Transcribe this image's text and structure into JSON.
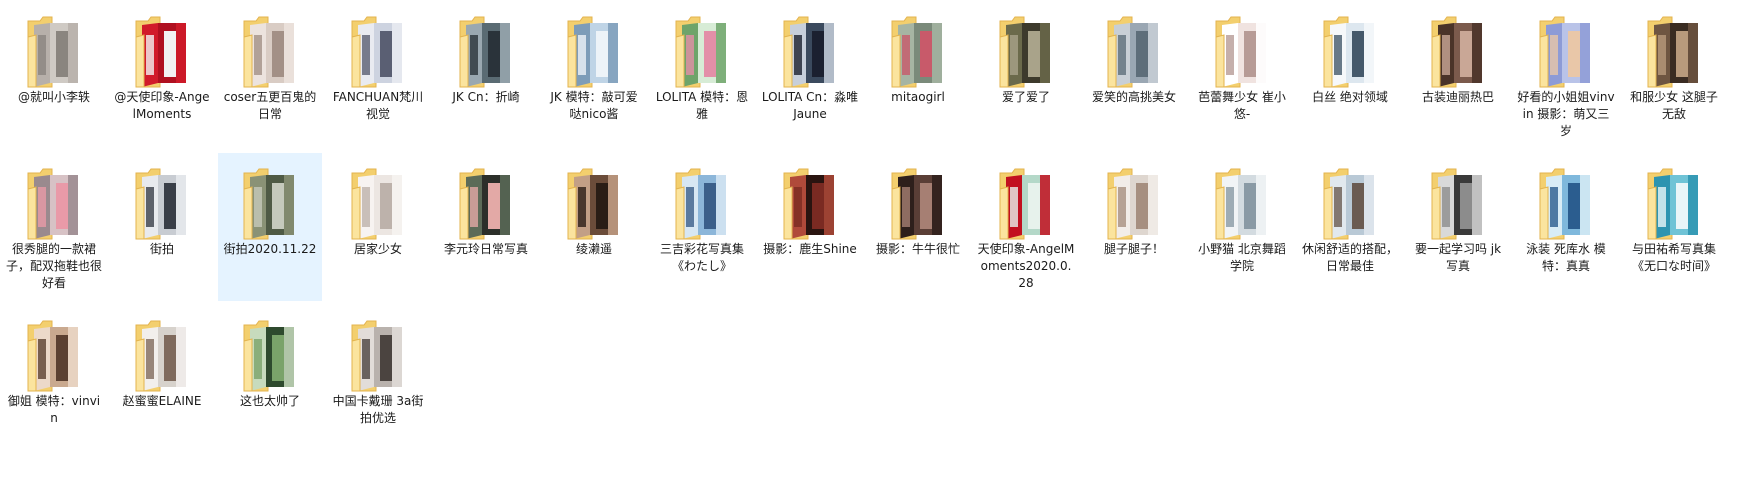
{
  "colors": {
    "folder_back": "#f3cf6e",
    "folder_front": "#fbe49e",
    "folder_edge": "#e3b34e",
    "selection": "#e5f3ff"
  },
  "folders": [
    {
      "name": "@就叫小李轶",
      "photo": [
        "#cfcac4",
        "#8a857f",
        "#b7b0aa"
      ],
      "selected": false
    },
    {
      "name": "@天使印象-AngelMoments",
      "photo": [
        "#b01020",
        "#f2f2f2",
        "#d11b2a"
      ],
      "selected": false
    },
    {
      "name": "coser五更百鬼的日常",
      "photo": [
        "#d9ccc4",
        "#a39086",
        "#ece3de"
      ],
      "selected": false
    },
    {
      "name": "FANCHUAN梵川视觉",
      "photo": [
        "#cdd3e0",
        "#5a5f73",
        "#e9ebf1"
      ],
      "selected": false
    },
    {
      "name": "JK Cn：折崎",
      "photo": [
        "#5a6b73",
        "#2a333a",
        "#9aa8b0"
      ],
      "selected": false
    },
    {
      "name": "JK 模特：敲可爱哒nico酱",
      "photo": [
        "#bfd4e6",
        "#edf3f8",
        "#7d9cb8"
      ],
      "selected": false
    },
    {
      "name": "LOLITA 模特：恩雅",
      "photo": [
        "#d7ecd6",
        "#e38fa8",
        "#6ea46a"
      ],
      "selected": false
    },
    {
      "name": "LOLITA Cn：淼唯Jaune",
      "photo": [
        "#3b4a5e",
        "#1b2030",
        "#c7cfdb"
      ],
      "selected": false
    },
    {
      "name": "mitaogirl",
      "photo": [
        "#7a8a7a",
        "#c85a6a",
        "#a6b5a3"
      ],
      "selected": false
    },
    {
      "name": "爱了爱了",
      "photo": [
        "#3d3a2c",
        "#a9a38a",
        "#6b6a4b"
      ],
      "selected": false
    },
    {
      "name": "爱笑的高挑美女",
      "photo": [
        "#9aa7b3",
        "#5e6e7a",
        "#c8cfd6"
      ],
      "selected": false
    },
    {
      "name": "芭蕾舞少女 崔小悠-",
      "photo": [
        "#f0e3e0",
        "#b79b96",
        "#ffffff"
      ],
      "selected": false
    },
    {
      "name": "白丝 绝对领域",
      "photo": [
        "#dde7ef",
        "#45596b",
        "#f6f8fa"
      ],
      "selected": false
    },
    {
      "name": "古装迪丽热巴",
      "photo": [
        "#7b5a4c",
        "#c9a796",
        "#4a3328"
      ],
      "selected": false
    },
    {
      "name": "好看的小姐姐vinvin 摄影：萌又三岁",
      "photo": [
        "#b9c3e8",
        "#e9c7a8",
        "#8d9bd6"
      ],
      "selected": false
    },
    {
      "name": "和服少女 这腿子无敌",
      "photo": [
        "#3a2c22",
        "#b89a7c",
        "#6e5541"
      ],
      "selected": false
    },
    {
      "name": "很秀腿的一款裙子，配双拖鞋也很好看",
      "photo": [
        "#d7c2c5",
        "#e99aa8",
        "#9a8a8e"
      ],
      "selected": false
    },
    {
      "name": "街拍",
      "photo": [
        "#c8ccd2",
        "#3a3f48",
        "#e8eaee"
      ],
      "selected": false
    },
    {
      "name": "街拍2020.11.22",
      "photo": [
        "#4f5a45",
        "#c5c9bc",
        "#8a9276"
      ],
      "selected": true
    },
    {
      "name": "居家少女",
      "photo": [
        "#ece6e2",
        "#bdb2ab",
        "#f7f3f1"
      ],
      "selected": false
    },
    {
      "name": "李元玲日常写真",
      "photo": [
        "#2c2f2a",
        "#e3a9a6",
        "#5c6b58"
      ],
      "selected": false
    },
    {
      "name": "绫濑遥",
      "photo": [
        "#6b4c3a",
        "#2a1d16",
        "#c29f86"
      ],
      "selected": false
    },
    {
      "name": "三吉彩花写真集《わたし》",
      "photo": [
        "#8cb6d9",
        "#3b5f8a",
        "#d7e7f3"
      ],
      "selected": false
    },
    {
      "name": "摄影：鹿生Shine",
      "photo": [
        "#2a1410",
        "#7a2a22",
        "#b04a3a"
      ],
      "selected": false
    },
    {
      "name": "摄影：牛牛很忙",
      "photo": [
        "#5a3e36",
        "#a67f73",
        "#2e1f1b"
      ],
      "selected": false
    },
    {
      "name": "天使印象-AngelMoments2020.0.28",
      "photo": [
        "#b4d8c8",
        "#e7f2ec",
        "#c2101f"
      ],
      "selected": false
    },
    {
      "name": "腿子腿子！",
      "photo": [
        "#ded6cf",
        "#a68f80",
        "#f2ede9"
      ],
      "selected": false
    },
    {
      "name": "小野猫 北京舞蹈学院",
      "photo": [
        "#d3dbe0",
        "#8a9aa5",
        "#f1f4f6"
      ],
      "selected": false
    },
    {
      "name": "休闲舒适的搭配，日常最佳",
      "photo": [
        "#b9c9d6",
        "#6a5b52",
        "#e1e8ee"
      ],
      "selected": false
    },
    {
      "name": "要一起学习吗 jk写真",
      "photo": [
        "#3a3a3a",
        "#8c8c8c",
        "#d9d9d9"
      ],
      "selected": false
    },
    {
      "name": "泳装 死库水 模特：真真",
      "photo": [
        "#7fb8dc",
        "#2b5d8f",
        "#d8ecf6"
      ],
      "selected": false
    },
    {
      "name": "与田祐希写真集《无口な时间》",
      "photo": [
        "#6fc3d6",
        "#e9f5f8",
        "#2d94b0"
      ],
      "selected": false
    },
    {
      "name": "御姐 模特：vinvin",
      "photo": [
        "#c9a98f",
        "#5b4031",
        "#ecd9c9"
      ],
      "selected": false
    },
    {
      "name": "赵蜜蜜ELAINE",
      "photo": [
        "#d7d2cc",
        "#7f6a5d",
        "#f2efec"
      ],
      "selected": false
    },
    {
      "name": "这也太帅了",
      "photo": [
        "#2e4a2e",
        "#7aa36a",
        "#c7dbbd"
      ],
      "selected": false
    },
    {
      "name": "中国卡戴珊 3a街拍优选",
      "photo": [
        "#b9b2ad",
        "#4b4440",
        "#e2ddd9"
      ],
      "selected": false
    }
  ]
}
